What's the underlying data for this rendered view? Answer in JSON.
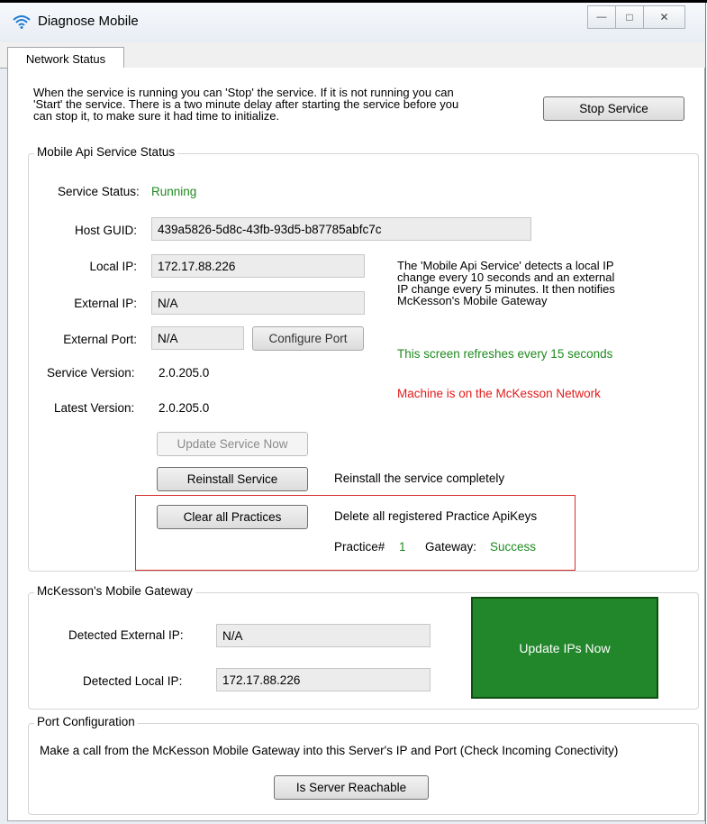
{
  "window": {
    "title": "Diagnose Mobile",
    "minimize_glyph": "—",
    "maximize_glyph": "□",
    "close_glyph": "✕"
  },
  "tabs": [
    {
      "label": "Network Status",
      "active": true
    }
  ],
  "intro": {
    "line1": "When the service is running you can 'Stop' the service. If it is not running you can",
    "line2": "'Start' the service. There is a two minute delay after starting the service before you",
    "line3": "can stop it, to make sure it had time to initialize.",
    "stop_button": "Stop Service"
  },
  "service_status": {
    "group_label": "Mobile Api Service Status",
    "status_label": "Service Status:",
    "status_value": "Running",
    "host_guid_label": "Host GUID:",
    "host_guid_value": "439a5826-5d8c-43fb-93d5-b87785abfc7c",
    "local_ip_label": "Local IP:",
    "local_ip_value": "172.17.88.226",
    "external_ip_label": "External IP:",
    "external_ip_value": "N/A",
    "external_port_label": "External Port:",
    "external_port_value": "N/A",
    "configure_port_button": "Configure Port",
    "service_version_label": "Service Version:",
    "service_version_value": "2.0.205.0",
    "latest_version_label": "Latest Version:",
    "latest_version_value": "2.0.205.0",
    "info_line1": "The 'Mobile Api Service' detects a local IP",
    "info_line2": "change every 10 seconds and an external",
    "info_line3": "IP change every 5 minutes. It then notifies",
    "info_line4": "McKesson's Mobile Gateway",
    "refresh_note": "This screen refreshes every 15 seconds",
    "network_note": "Machine is on the McKesson Network",
    "update_button": "Update Service Now",
    "reinstall_button": "Reinstall Service",
    "reinstall_desc": "Reinstall the service completely",
    "clear_button": "Clear all Practices",
    "clear_desc": "Delete all registered Practice ApiKeys",
    "practice_label": "Practice#",
    "practice_value": "1",
    "gateway_label": "Gateway:",
    "gateway_value": "Success"
  },
  "gateway": {
    "group_label": "McKesson's Mobile Gateway",
    "detected_external_label": "Detected External IP:",
    "detected_external_value": "N/A",
    "detected_local_label": "Detected Local IP:",
    "detected_local_value": "172.17.88.226",
    "update_ips_button": "Update IPs Now"
  },
  "port_config": {
    "group_label": "Port Configuration",
    "description": "Make a call from the McKesson Mobile Gateway into this Server's IP and Port (Check Incoming Conectivity)",
    "reachable_button": "Is Server Reachable"
  },
  "colors": {
    "status_green": "#1e8a1e",
    "alert_red": "#e21b1b",
    "highlight_box": "#d42d2d",
    "update_ips_bg": "#22862b"
  }
}
